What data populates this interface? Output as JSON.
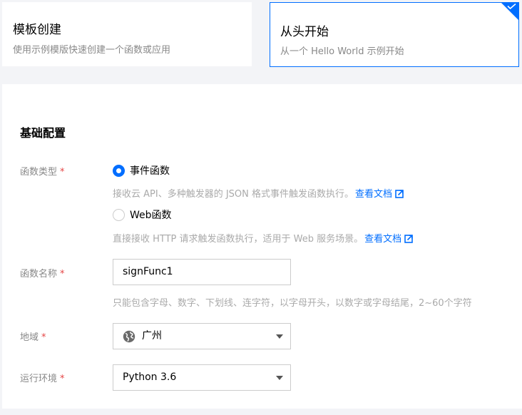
{
  "cards": {
    "template": {
      "title": "模板创建",
      "desc": "使用示例模版快速创建一个函数或应用"
    },
    "scratch": {
      "title": "从头开始",
      "desc": "从一个 Hello World 示例开始",
      "selected": true
    }
  },
  "config": {
    "section_title": "基础配置",
    "function_type": {
      "label": "函数类型",
      "required_mark": "*",
      "options": [
        {
          "label": "事件函数",
          "checked": true,
          "help": "接收云 API、多种触发器的 JSON 格式事件触发函数执行。",
          "doc_link": "查看文档"
        },
        {
          "label": "Web函数",
          "checked": false,
          "help": "直接接收 HTTP 请求触发函数执行，适用于 Web 服务场景。",
          "doc_link": "查看文档"
        }
      ]
    },
    "function_name": {
      "label": "函数名称",
      "required_mark": "*",
      "value": "signFunc1",
      "help": "只能包含字母、数字、下划线、连字符，以字母开头，以数字或字母结尾，2~60个字符"
    },
    "region": {
      "label": "地域",
      "required_mark": "*",
      "value": "广州",
      "icon": "globe-icon"
    },
    "runtime": {
      "label": "运行环境",
      "required_mark": "*",
      "value": "Python 3.6"
    }
  },
  "colors": {
    "accent": "#006eff",
    "required": "#e54545",
    "muted": "#888888"
  }
}
